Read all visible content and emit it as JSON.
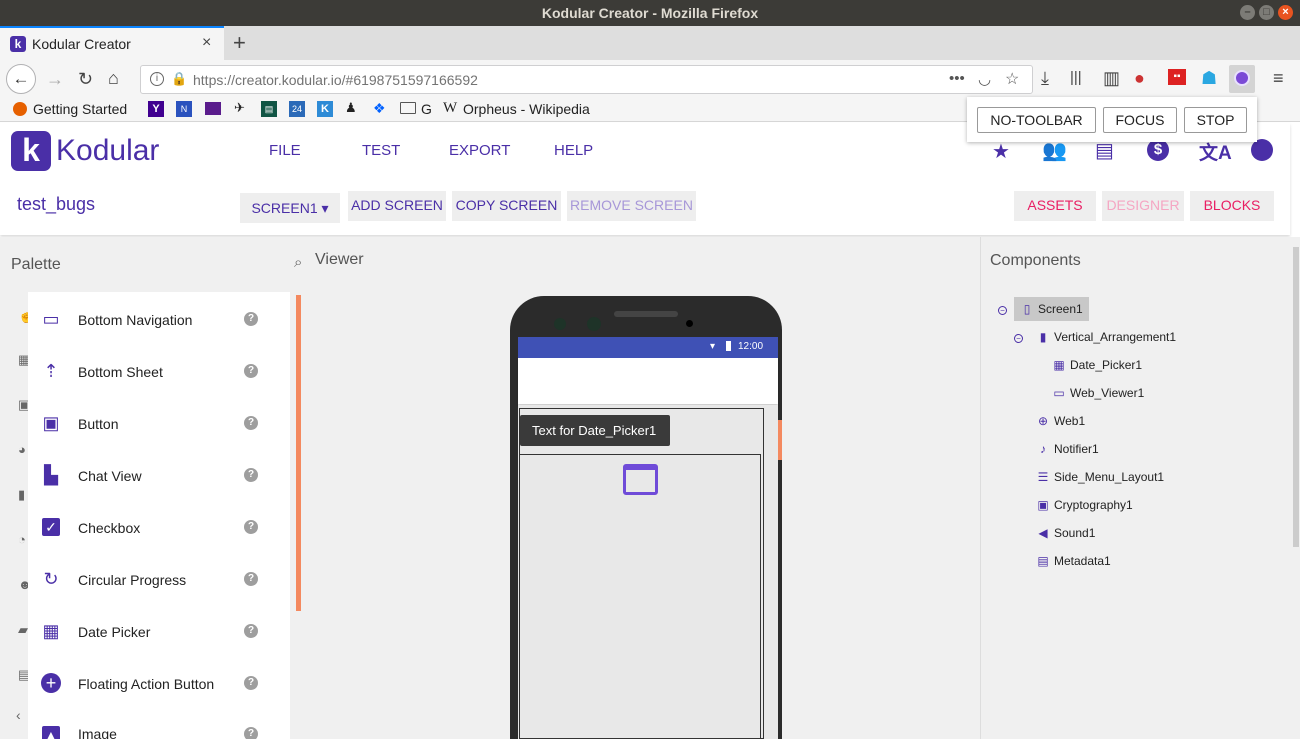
{
  "window": {
    "title": "Kodular Creator - Mozilla Firefox"
  },
  "browser": {
    "tab_title": "Kodular Creator",
    "url": "https://creator.kodular.io/#6198751597166592",
    "bookmarks": [
      "Getting Started",
      "G",
      "Orpheus - Wikipedia"
    ]
  },
  "overlay": {
    "buttons": [
      "NO-TOOLBAR",
      "FOCUS",
      "STOP"
    ]
  },
  "app": {
    "logo_text": "Kodular",
    "menu": [
      "FILE",
      "TEST",
      "EXPORT",
      "HELP"
    ],
    "project_name": "test_bugs",
    "screen_select": "SCREEN1 ▾",
    "add_screen": "ADD SCREEN",
    "copy_screen": "COPY SCREEN",
    "remove_screen": "REMOVE SCREEN",
    "assets": "ASSETS",
    "designer": "DESIGNER",
    "blocks": "BLOCKS"
  },
  "palette": {
    "title": "Palette",
    "items": [
      {
        "label": "Bottom Navigation",
        "icon": "bottom-navigation-icon"
      },
      {
        "label": "Bottom Sheet",
        "icon": "bottom-sheet-icon"
      },
      {
        "label": "Button",
        "icon": "button-icon"
      },
      {
        "label": "Chat View",
        "icon": "chat-icon"
      },
      {
        "label": "Checkbox",
        "icon": "checkbox-icon"
      },
      {
        "label": "Circular Progress",
        "icon": "circular-progress-icon"
      },
      {
        "label": "Date Picker",
        "icon": "calendar-icon"
      },
      {
        "label": "Floating Action Button",
        "icon": "plus-circle-icon"
      },
      {
        "label": "Image",
        "icon": "image-icon"
      }
    ]
  },
  "viewer": {
    "title": "Viewer",
    "status_time": "12:00",
    "date_picker_text": "Text for Date_Picker1"
  },
  "components": {
    "title": "Components",
    "tree": [
      {
        "label": "Screen1"
      },
      {
        "label": "Vertical_Arrangement1"
      },
      {
        "label": "Date_Picker1"
      },
      {
        "label": "Web_Viewer1"
      },
      {
        "label": "Web1"
      },
      {
        "label": "Notifier1"
      },
      {
        "label": "Side_Menu_Layout1"
      },
      {
        "label": "Cryptography1"
      },
      {
        "label": "Sound1"
      },
      {
        "label": "Metadata1"
      }
    ]
  },
  "colors": {
    "accent": "#4a2fa7",
    "pink": "#e91e63",
    "firefox_blue": "#0a84ff"
  }
}
